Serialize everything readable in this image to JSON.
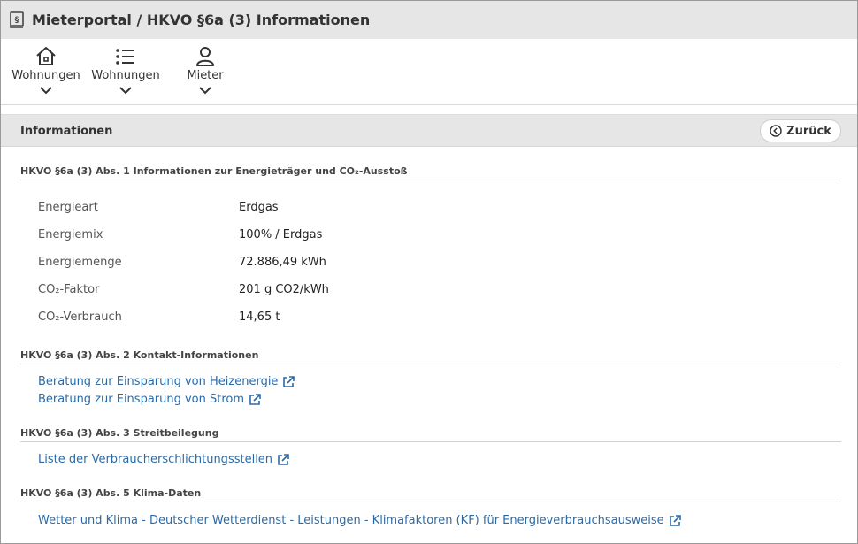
{
  "window": {
    "title": "Mieterportal / HKVO §6a (3) Informationen",
    "app_icon": "law-book-icon"
  },
  "toolbar": {
    "items": [
      {
        "label": "Wohnungen",
        "icon": "house-icon"
      },
      {
        "label": "Wohnungen",
        "icon": "list-icon"
      },
      {
        "label": "Mieter",
        "icon": "person-icon"
      }
    ]
  },
  "panel": {
    "title": "Informationen",
    "back_label": "Zurück"
  },
  "sections": {
    "energy": {
      "heading": "HKVO §6a (3) Abs. 1 Informationen zur Energieträger und CO₂-Ausstoß",
      "rows": [
        {
          "key": "Energieart",
          "value": "Erdgas"
        },
        {
          "key": "Energiemix",
          "value": "100% / Erdgas"
        },
        {
          "key": "Energiemenge",
          "value": "72.886,49 kWh"
        },
        {
          "key": "CO₂-Faktor",
          "value": "201 g CO2/kWh"
        },
        {
          "key": "CO₂-Verbrauch",
          "value": "14,65 t"
        }
      ]
    },
    "contact": {
      "heading": "HKVO §6a (3) Abs. 2 Kontakt-Informationen",
      "links": [
        "Beratung zur Einsparung von Heizenergie",
        "Beratung zur Einsparung von Strom"
      ]
    },
    "dispute": {
      "heading": "HKVO §6a (3) Abs. 3 Streitbeilegung",
      "links": [
        "Liste der Verbraucherschlichtungsstellen"
      ]
    },
    "climate": {
      "heading": "HKVO §6a (3) Abs. 5 Klima-Daten",
      "links": [
        "Wetter und Klima - Deutscher Wetterdienst - Leistungen - Klimafaktoren (KF) für Energieverbrauchsausweise"
      ]
    }
  },
  "colors": {
    "link": "#2b6aa6",
    "header_bg": "#e6e6e6"
  }
}
